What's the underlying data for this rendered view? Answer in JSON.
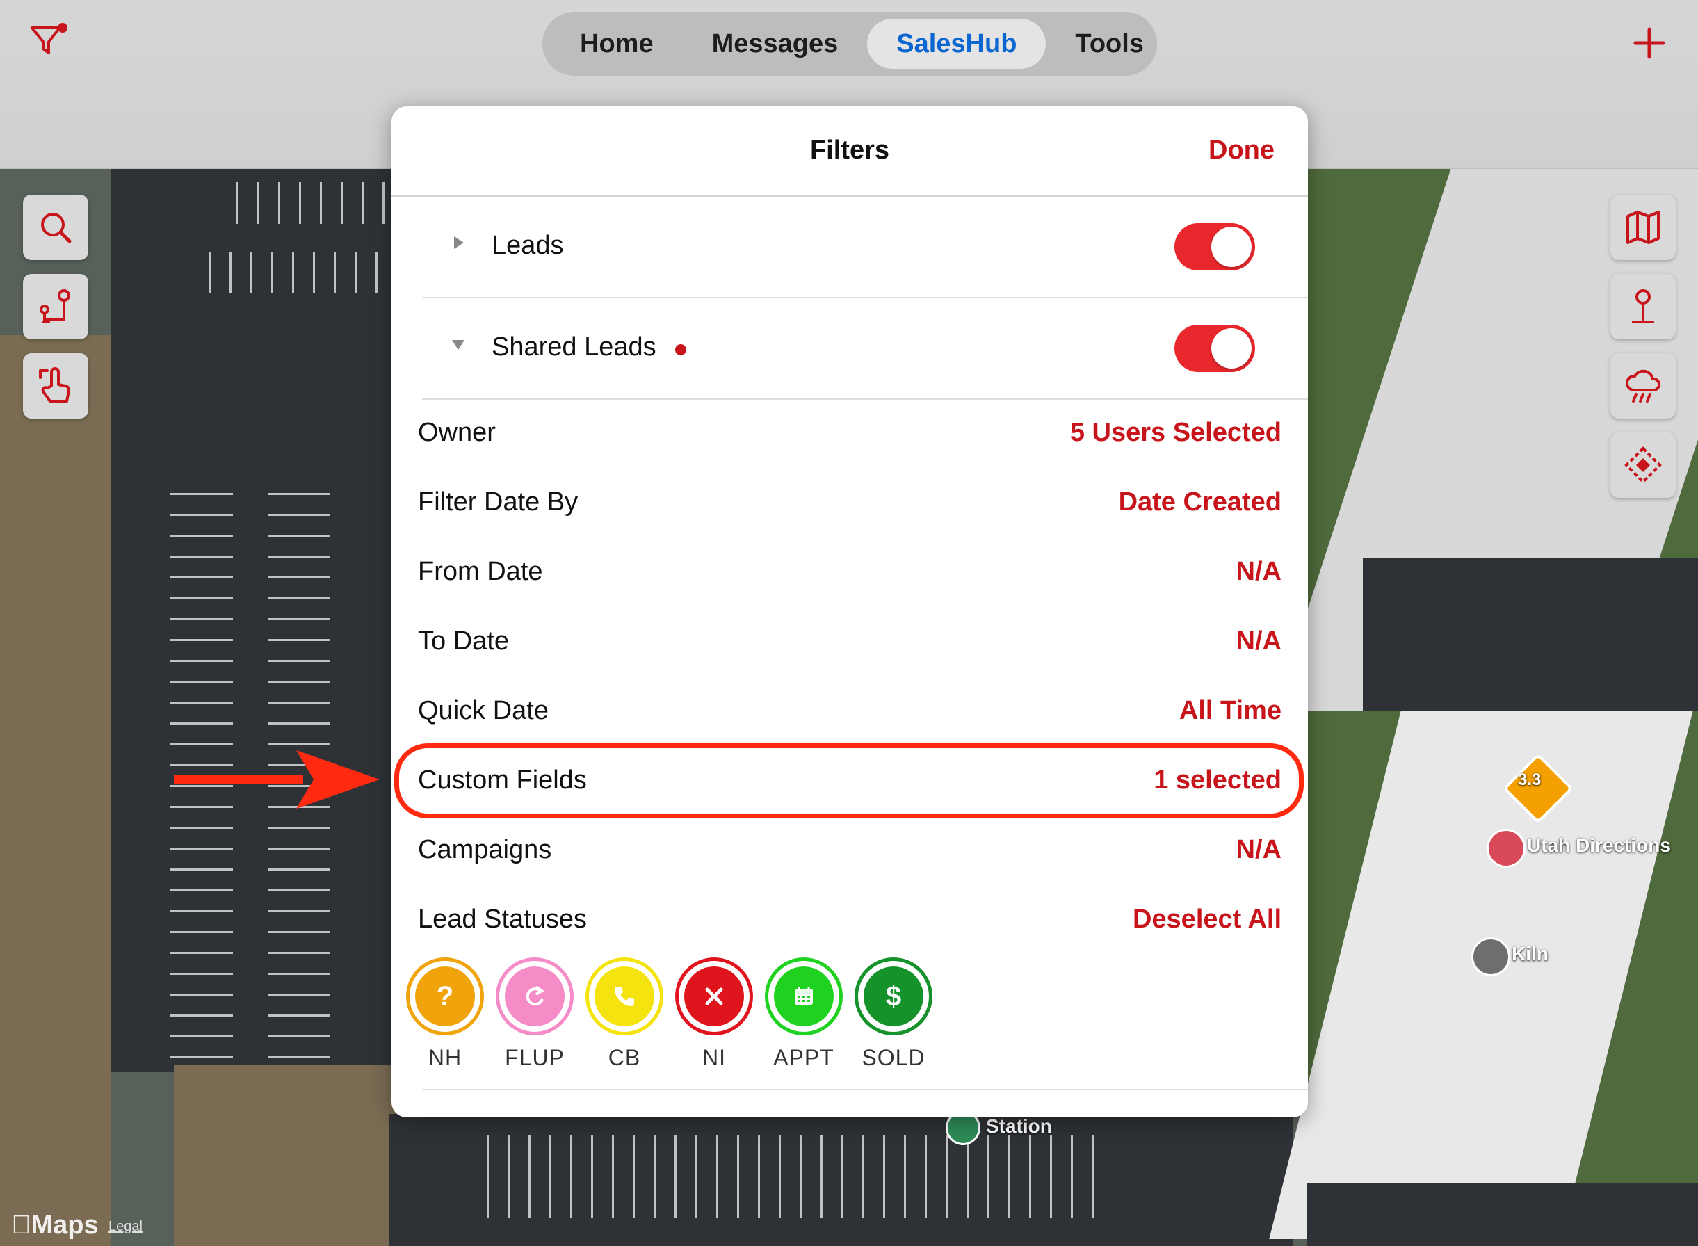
{
  "nav": {
    "tabs": [
      {
        "label": "Home"
      },
      {
        "label": "Messages"
      },
      {
        "label": "SalesHub"
      },
      {
        "label": "Tools"
      }
    ],
    "active_tab": "SalesHub"
  },
  "filters_modal": {
    "title": "Filters",
    "done_label": "Done",
    "toggles": [
      {
        "label": "Leads",
        "on": true,
        "expanded": false
      },
      {
        "label": "Shared Leads",
        "on": true,
        "expanded": true,
        "has_indicator": true
      }
    ],
    "rows": [
      {
        "label": "Owner",
        "value": "5 Users Selected"
      },
      {
        "label": "Filter Date By",
        "value": "Date Created"
      },
      {
        "label": "From Date",
        "value": "N/A"
      },
      {
        "label": "To Date",
        "value": "N/A"
      },
      {
        "label": "Quick Date",
        "value": "All Time"
      },
      {
        "label": "Custom Fields",
        "value": "1 selected"
      },
      {
        "label": "Campaigns",
        "value": "N/A"
      },
      {
        "label": "Lead Statuses",
        "value": "Deselect All"
      }
    ],
    "lead_statuses": [
      {
        "code": "NH",
        "icon": "question-mark-icon",
        "color": "#f0a30a"
      },
      {
        "code": "FLUP",
        "icon": "refresh-icon",
        "color": "#f58cc8"
      },
      {
        "code": "CB",
        "icon": "phone-icon",
        "color": "#f5e30f"
      },
      {
        "code": "NI",
        "icon": "x-icon",
        "color": "#e0141c"
      },
      {
        "code": "APPT",
        "icon": "calendar-icon",
        "color": "#1fd21f"
      },
      {
        "code": "SOLD",
        "icon": "dollar-icon",
        "color": "#15932a"
      }
    ]
  },
  "map": {
    "poi": [
      {
        "label": "Utah Directions"
      },
      {
        "label": "Kiln"
      },
      {
        "label": "Station"
      }
    ],
    "distance_badge": "3.3",
    "attribution": "Maps",
    "legal": "Legal"
  },
  "colors": {
    "accent_red": "#c8151b",
    "active_tab_blue": "#0a66d0",
    "annotation_red": "#ff2a10"
  }
}
